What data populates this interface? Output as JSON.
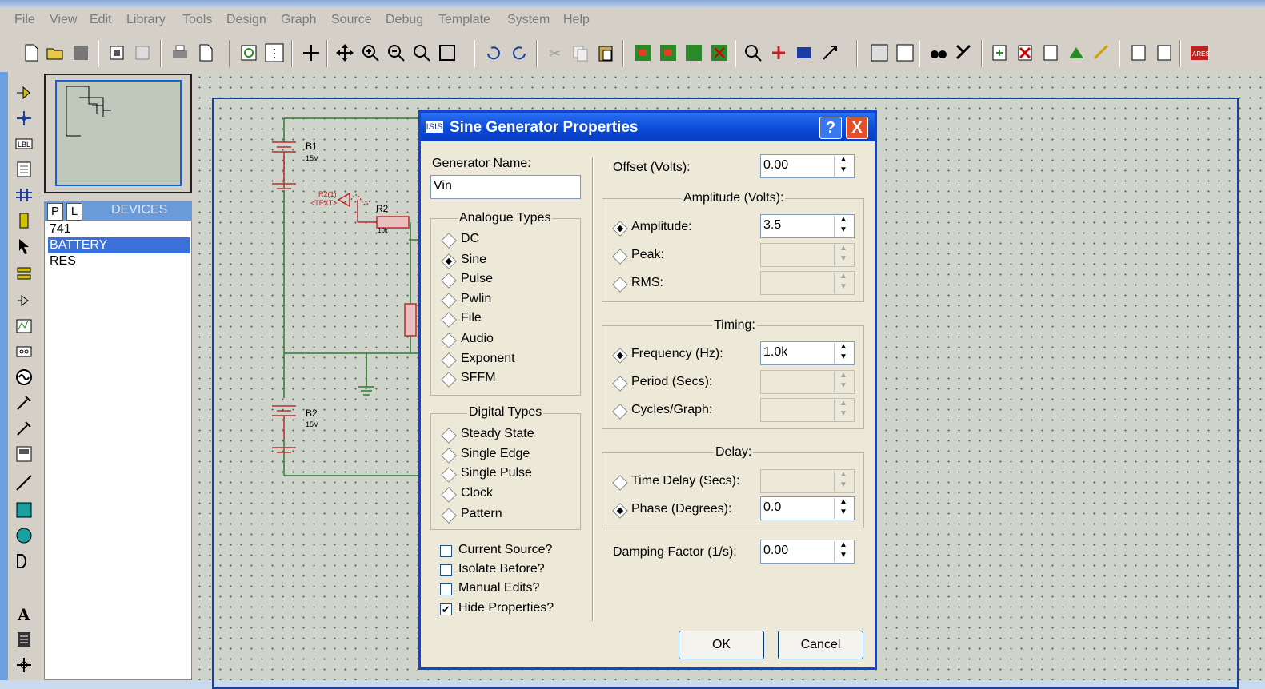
{
  "menu": [
    "File",
    "View",
    "Edit",
    "Library",
    "Tools",
    "Design",
    "Graph",
    "Source",
    "Debug",
    "Template",
    "System",
    "Help"
  ],
  "left_panel": {
    "tabs": [
      "P",
      "L"
    ],
    "header": "DEVICES",
    "devices": [
      "741",
      "BATTERY",
      "RES"
    ],
    "selected_device": "BATTERY"
  },
  "schematic": {
    "b1_label": "B1",
    "b1_value": "15V",
    "b2_label": "B2",
    "b2_value": "15V",
    "r2_label": "R2",
    "r2_value": "10k",
    "probe_ref": "R2(1)",
    "probe_text": "<TEXT>"
  },
  "dialog": {
    "title": "Sine Generator Properties",
    "help_button": "?",
    "close_button": "X",
    "generator_name_label": "Generator Name:",
    "generator_name_value": "Vin",
    "analogue_title": "Analogue Types",
    "analogue_types": [
      "DC",
      "Sine",
      "Pulse",
      "Pwlin",
      "File",
      "Audio",
      "Exponent",
      "SFFM"
    ],
    "analogue_selected": "Sine",
    "digital_title": "Digital Types",
    "digital_types": [
      "Steady State",
      "Single Edge",
      "Single Pulse",
      "Clock",
      "Pattern"
    ],
    "checkboxes": [
      {
        "label": "Current Source?",
        "checked": false
      },
      {
        "label": "Isolate Before?",
        "checked": false
      },
      {
        "label": "Manual Edits?",
        "checked": false
      },
      {
        "label": "Hide Properties?",
        "checked": true
      }
    ],
    "offset_label": "Offset (Volts):",
    "offset_value": "0.00",
    "amplitude_group": "Amplitude (Volts):",
    "amplitude_label": "Amplitude:",
    "amplitude_value": "3.5",
    "peak_label": "Peak:",
    "rms_label": "RMS:",
    "timing_group": "Timing:",
    "frequency_label": "Frequency (Hz):",
    "frequency_value": "1.0k",
    "period_label": "Period (Secs):",
    "cycles_label": "Cycles/Graph:",
    "delay_group": "Delay:",
    "time_delay_label": "Time Delay (Secs):",
    "phase_label": "Phase (Degrees):",
    "phase_value": "0.0",
    "damping_label": "Damping Factor (1/s):",
    "damping_value": "0.00",
    "ok": "OK",
    "cancel": "Cancel"
  },
  "colors": {
    "title_blue": "#0a48d8",
    "wire_green": "#2e7d32",
    "component_red": "#b03030",
    "selection_blue": "#3a70d8"
  }
}
